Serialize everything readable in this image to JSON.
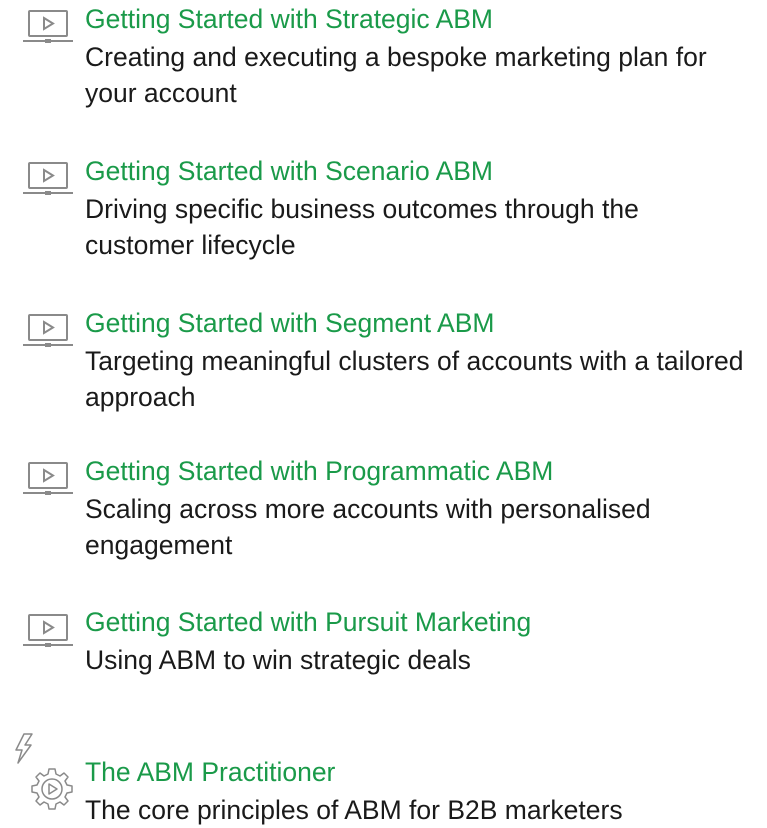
{
  "courses": [
    {
      "title": "Getting Started with Strategic ABM",
      "description": "Creating and executing a bespoke marketing plan for your account",
      "icon": "video-screen-icon"
    },
    {
      "title": "Getting Started with Scenario ABM",
      "description": "Driving specific business outcomes through the customer lifecycle",
      "icon": "video-screen-icon"
    },
    {
      "title": "Getting Started with Segment ABM",
      "description": "Targeting meaningful clusters of accounts with a tailored approach",
      "icon": "video-screen-icon"
    },
    {
      "title": "Getting Started with Programmatic ABM",
      "description": "Scaling across more accounts with personalised engagement",
      "icon": "video-screen-icon"
    },
    {
      "title": "Getting Started with Pursuit Marketing",
      "description": "Using ABM to win strategic deals",
      "icon": "video-screen-icon"
    }
  ],
  "practitioner": {
    "title": "The ABM Practitioner",
    "description": "The core principles of ABM for B2B marketers",
    "icon": "lightning-gear-icon"
  },
  "colors": {
    "title_green": "#1a9a49",
    "body_text": "#1a1a1a",
    "icon_grey": "#8a8a8a"
  }
}
